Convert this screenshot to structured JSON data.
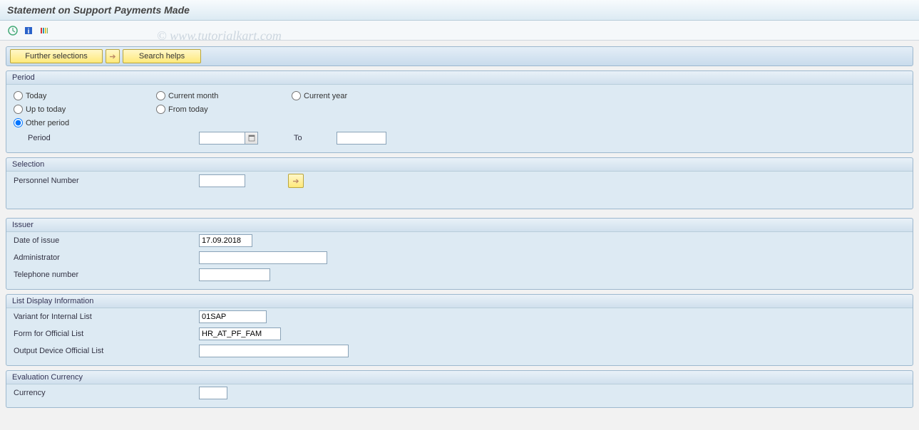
{
  "header": {
    "title": "Statement on Support Payments Made"
  },
  "watermark": "© www.tutorialkart.com",
  "toolbar": {
    "execute_icon": "execute",
    "info_icon": "information",
    "variant_icon": "variant"
  },
  "buttons": {
    "further_selections": "Further selections",
    "search_helps": "Search helps"
  },
  "period": {
    "title": "Period",
    "today": "Today",
    "current_month": "Current month",
    "current_year": "Current year",
    "up_to_today": "Up to today",
    "from_today": "From today",
    "other_period": "Other period",
    "selected": "other_period",
    "period_label": "Period",
    "period_from": "",
    "period_to_label": "To",
    "period_to": ""
  },
  "selection": {
    "title": "Selection",
    "personnel_number_label": "Personnel Number",
    "personnel_number": ""
  },
  "issuer": {
    "title": "Issuer",
    "date_of_issue_label": "Date of issue",
    "date_of_issue": "17.09.2018",
    "administrator_label": "Administrator",
    "administrator": "",
    "telephone_label": "Telephone number",
    "telephone": ""
  },
  "list_display": {
    "title": "List Display Information",
    "variant_label": "Variant for Internal List",
    "variant": "01SAP",
    "form_label": "Form for Official List",
    "form": "HR_AT_PF_FAM",
    "output_device_label": "Output Device Official List",
    "output_device": ""
  },
  "eval_currency": {
    "title": "Evaluation Currency",
    "currency_label": "Currency",
    "currency": ""
  }
}
